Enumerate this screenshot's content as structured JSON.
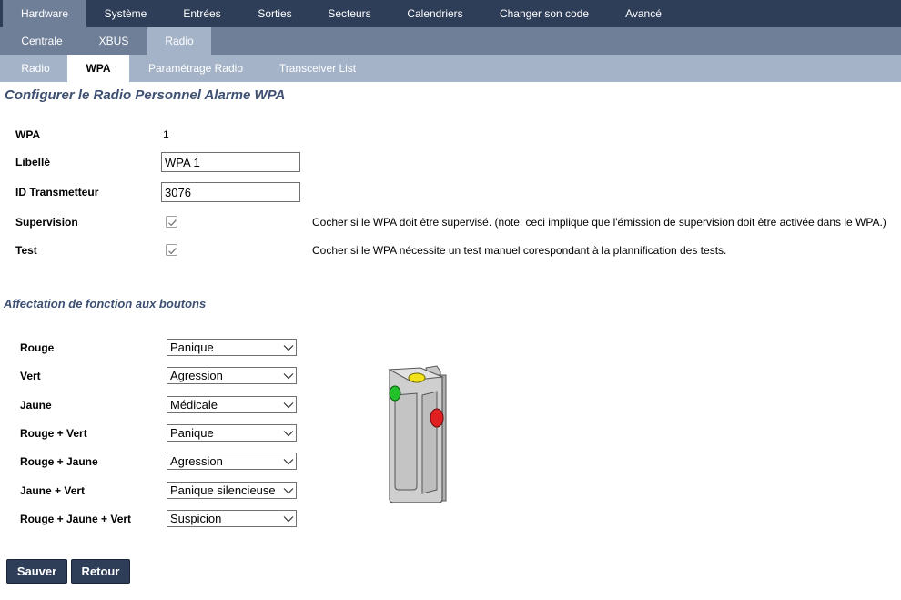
{
  "nav": {
    "primary": [
      {
        "label": "Hardware",
        "active": true
      },
      {
        "label": "Système",
        "active": false
      },
      {
        "label": "Entrées",
        "active": false
      },
      {
        "label": "Sorties",
        "active": false
      },
      {
        "label": "Secteurs",
        "active": false
      },
      {
        "label": "Calendriers",
        "active": false
      },
      {
        "label": "Changer son code",
        "active": false
      },
      {
        "label": "Avancé",
        "active": false
      }
    ],
    "secondary": [
      {
        "label": "Centrale",
        "active": false
      },
      {
        "label": "XBUS",
        "active": false
      },
      {
        "label": "Radio",
        "active": true
      }
    ],
    "tertiary": [
      {
        "label": "Radio",
        "active": false
      },
      {
        "label": "WPA",
        "active": true
      },
      {
        "label": "Paramétrage Radio",
        "active": false
      },
      {
        "label": "Transceiver List",
        "active": false
      }
    ]
  },
  "page": {
    "title": "Configurer le Radio Personnel Alarme WPA",
    "section_buttons_title": "Affectation de fonction aux boutons"
  },
  "config": {
    "wpa": {
      "label": "WPA",
      "value": "1"
    },
    "libelle": {
      "label": "Libellé",
      "value": "WPA 1"
    },
    "id_transmetteur": {
      "label": "ID Transmetteur",
      "value": "3076"
    },
    "supervision": {
      "label": "Supervision",
      "checked": true,
      "note": "Cocher si le WPA doit être supervisé. (note: ceci implique que l'émission de supervision doit être activée dans le WPA.)"
    },
    "test": {
      "label": "Test",
      "checked": true,
      "note": "Cocher si le WPA nécessite un test manuel corespondant à la plannification des tests."
    }
  },
  "buttons_assignment": [
    {
      "label": "Rouge",
      "value": "Panique"
    },
    {
      "label": "Vert",
      "value": "Agression"
    },
    {
      "label": "Jaune",
      "value": "Médicale"
    },
    {
      "label": "Rouge + Vert",
      "value": "Panique"
    },
    {
      "label": "Rouge + Jaune",
      "value": "Agression"
    },
    {
      "label": "Jaune + Vert",
      "value": "Panique silencieuse"
    },
    {
      "label": "Rouge + Jaune + Vert",
      "value": "Suspicion"
    }
  ],
  "actions": {
    "save": "Sauver",
    "back": "Retour"
  },
  "colors": {
    "nav_primary": "#2e3d58",
    "nav_secondary": "#6f7f98",
    "nav_tertiary": "#a5b3c8",
    "heading": "#3d4f72",
    "button_red": "#e02020",
    "button_green": "#22c02a",
    "button_yellow": "#f2e21a"
  }
}
